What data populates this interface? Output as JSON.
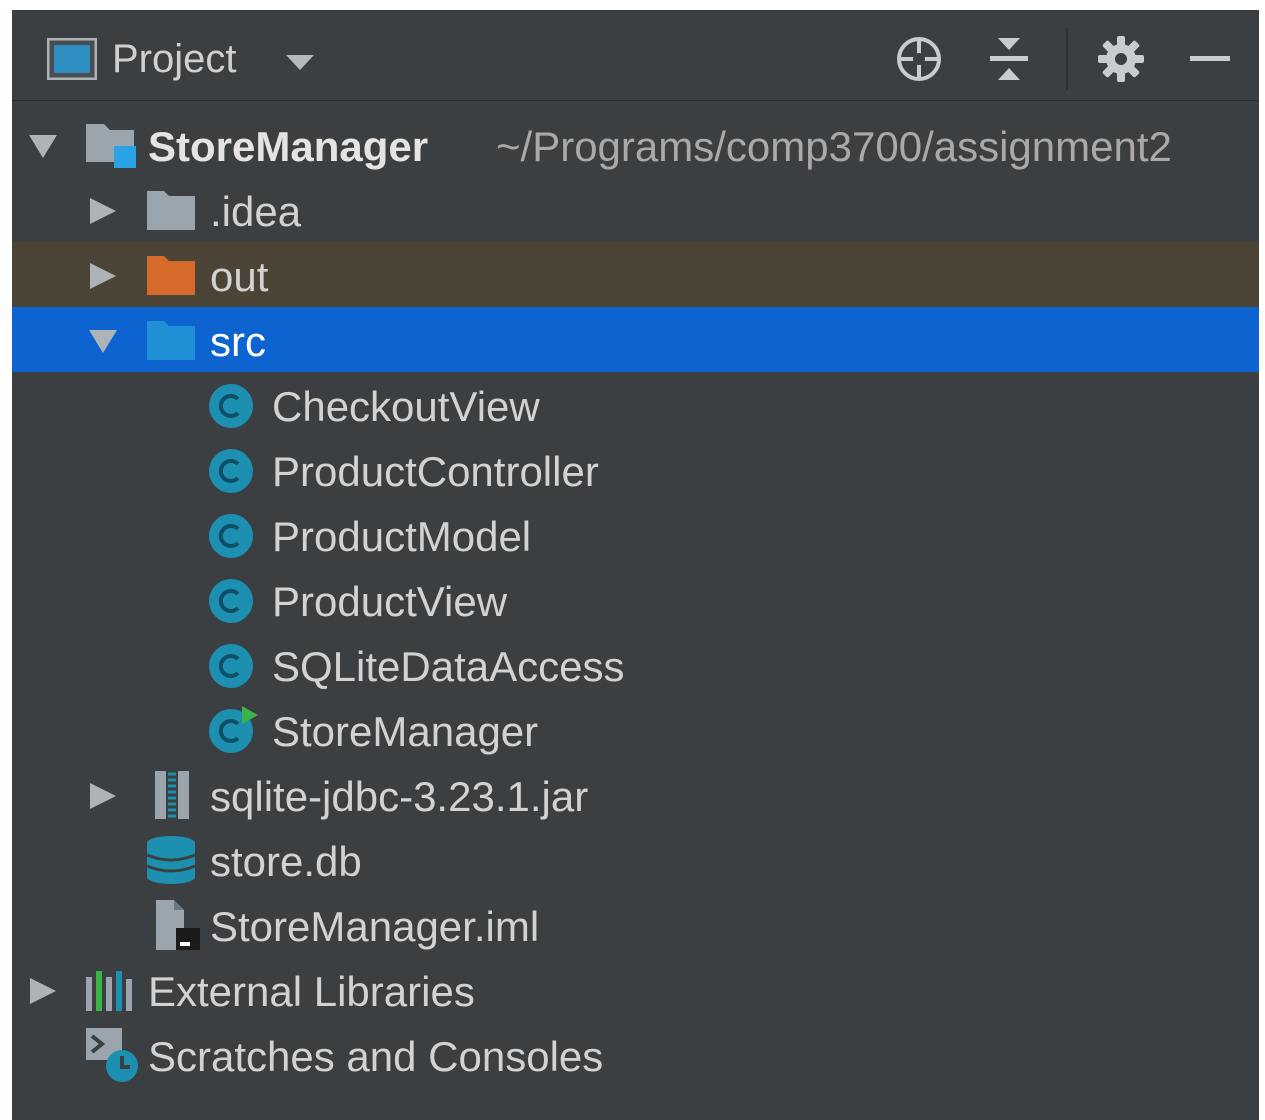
{
  "toolbar": {
    "title": "Project",
    "icons": [
      "project-view-icon",
      "dropdown-arrow-icon",
      "locate-icon",
      "collapse-all-icon",
      "gear-icon",
      "minimize-icon"
    ]
  },
  "colors": {
    "panel_bg": "#3c3f41",
    "selection": "#0d63cf",
    "excluded_bg": "#4b4336",
    "folder_gray": "#9aa5ad",
    "folder_orange": "#d66a2a",
    "folder_blue": "#1f90d6",
    "class_teal": "#1d8fb0"
  },
  "tree": {
    "root": {
      "name": "StoreManager",
      "path": "~/Programs/comp3700/assignment2"
    },
    "idea": ".idea",
    "out": "out",
    "src": "src",
    "classes": [
      "CheckoutView",
      "ProductController",
      "ProductModel",
      "ProductView",
      "SQLiteDataAccess",
      "StoreManager"
    ],
    "jar": "sqlite-jdbc-3.23.1.jar",
    "db": "store.db",
    "iml": "StoreManager.iml",
    "external": "External Libraries",
    "scratches": "Scratches and Consoles"
  }
}
